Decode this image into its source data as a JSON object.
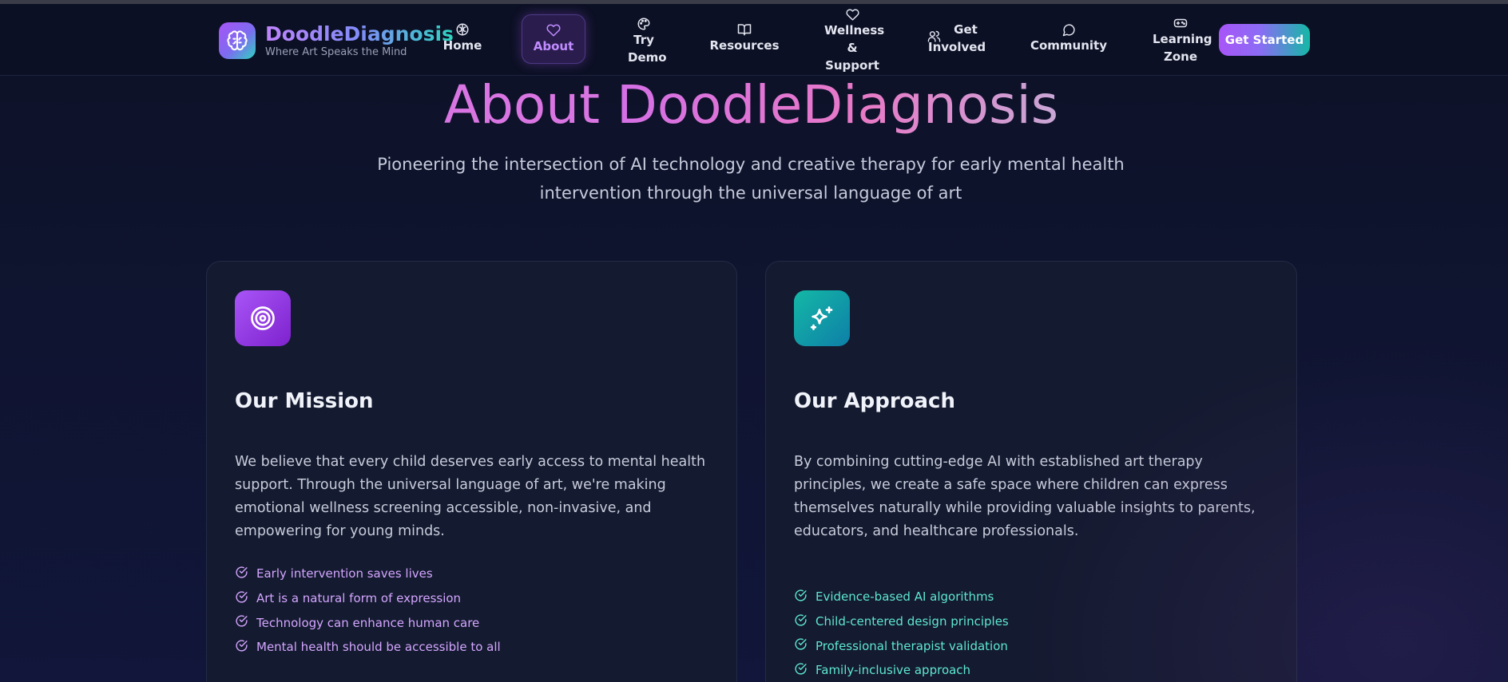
{
  "brand": {
    "name": "DoodleDiagnosis",
    "tagline": "Where Art Speaks the Mind",
    "logo_icon": "brain-icon"
  },
  "nav": {
    "items": [
      {
        "label": "Home",
        "icon": "brain-icon"
      },
      {
        "label": "About",
        "icon": "heart-icon",
        "active": true
      },
      {
        "label": "Try Demo",
        "icon": "palette-icon"
      },
      {
        "label": "Resources",
        "icon": "book-icon"
      },
      {
        "label": "Wellness & Support",
        "icon": "heart-icon"
      },
      {
        "label": "Get Involved",
        "icon": "users-icon"
      },
      {
        "label": "Community",
        "icon": "chat-icon"
      },
      {
        "label": "Learning Zone",
        "icon": "gamepad-icon"
      }
    ],
    "cta_label": "Get Started"
  },
  "hero": {
    "title_prefix": "About",
    "title_highlight": "DoodleDiagnosis",
    "subtitle": "Pioneering the intersection of AI technology and creative therapy for early mental health intervention through the universal language of art"
  },
  "mission": {
    "icon": "target-icon",
    "title": "Our Mission",
    "text": "We believe that every child deserves early access to mental health support. Through the universal language of art, we're making emotional wellness screening accessible, non-invasive, and empowering for young minds.",
    "points": [
      "Early intervention saves lives",
      "Art is a natural form of expression",
      "Technology can enhance human care",
      "Mental health should be accessible to all"
    ]
  },
  "approach": {
    "icon": "sparkles-icon",
    "title": "Our Approach",
    "text": "By combining cutting-edge AI with established art therapy principles, we create a safe space where children can express themselves naturally while providing valuable insights to parents, educators, and healthcare professionals.",
    "points": [
      "Evidence-based AI algorithms",
      "Child-centered design principles",
      "Professional therapist validation",
      "Family-inclusive approach"
    ]
  },
  "colors": {
    "background": "#0d1126",
    "card": "#141a30",
    "accent_purple": "#a855f7",
    "accent_teal": "#14b8a6",
    "mission_check": "#d4a6ff",
    "approach_check": "#5ee7d0"
  }
}
